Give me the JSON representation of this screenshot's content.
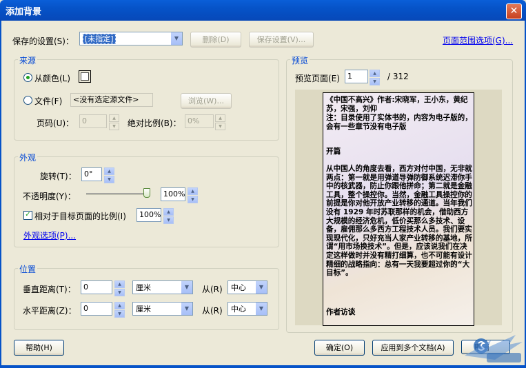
{
  "window": {
    "title": "添加背景",
    "close_glyph": "✕"
  },
  "top": {
    "saved_settings_label": "保存的设置(S)：",
    "saved_settings_value": "[未指定]",
    "delete_button": "删除(D)",
    "save_settings_button": "保存设置(V)...",
    "page_range_link": "页面范围选项(G)..."
  },
  "source": {
    "legend": "来源",
    "from_color_label": "从颜色(L)",
    "file_label": "文件(F)",
    "file_value": "<没有选定源文件>",
    "browse_button": "浏览(W)...",
    "page_number_label": "页码(U)：",
    "page_number_value": "0",
    "absolute_scale_label": "绝对比例(B)：",
    "absolute_scale_value": "0%"
  },
  "appearance": {
    "legend": "外观",
    "rotation_label": "旋转(T)：",
    "rotation_value": "0°",
    "opacity_label": "不透明度(Y)：",
    "opacity_value": "100%",
    "opacity_fraction": 1.0,
    "relative_scale_label": "相对于目标页面的比例(I)",
    "relative_scale_value": "100%",
    "relative_scale_checked": true,
    "appearance_options_link": "外观选项(P)..."
  },
  "position": {
    "legend": "位置",
    "vertical_label": "垂直距离(T)：",
    "vertical_value": "0",
    "vertical_unit": "厘米",
    "vertical_from_label": "从(R)",
    "vertical_from_value": "中心",
    "horizontal_label": "水平距离(Z)：",
    "horizontal_value": "0",
    "horizontal_unit": "厘米",
    "horizontal_from_label": "从(R)",
    "horizontal_from_value": "中心"
  },
  "preview": {
    "legend": "预览",
    "page_label": "预览页面(E)",
    "page_value": "1",
    "page_total": "/ 312",
    "content": {
      "para1": "《中国不高兴》作者:宋晓军，王小东，黄纪苏，宋强，刘仰",
      "para2": "注：目录使用了实体书的，内容为电子版的，会有一些章节没有电子版",
      "heading1": "开篇",
      "para3": "从中国人的角度去看，西方对付中国，无非就两点：第一就是用弹道导弹防御系统迟滞你手中的核武器，防止你跟他拼命；第二就是金融工具，整个操控你。当然，金融工具操控你的前提是你对他开放产业转移的通道。当年我们没有 1929 年时苏联那样的机会，借助西方大规模的经济危机，低价买那么多技术、设备，雇佣那么多西方工程技术人员。我们要实现现代化，只好充当人家产业转移的基地，所谓“用市场换技术”。但是，应该说我们在决定这样做时并没有精打细算，也不可能有设计精细的战略指向：总有一天我要超过你的“大目标”。",
      "heading2": "作者访谈"
    }
  },
  "bottom": {
    "help_button": "帮助(H)",
    "ok_button": "确定(O)",
    "apply_multiple_button": "应用到多个文档(A)",
    "cancel_button": "取消"
  },
  "colors": {
    "title_bar": "#0653c8",
    "legend_text": "#0046d5",
    "dialog_bg": "#ece9d8",
    "selected_combo": "#316ac5"
  }
}
